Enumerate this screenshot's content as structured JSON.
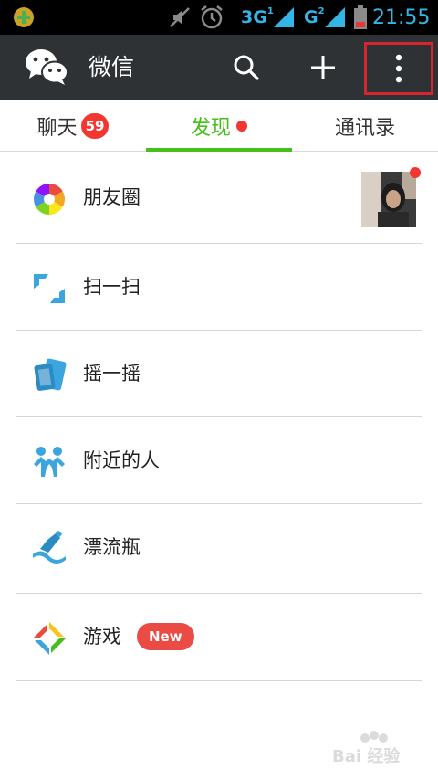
{
  "status_bar": {
    "network1": "3G",
    "sim1_tag": "1",
    "network2": "G",
    "sim2_tag": "2",
    "time": "21:55"
  },
  "action_bar": {
    "title": "微信",
    "icons": [
      "wechat-logo-icon",
      "search-icon",
      "plus-icon",
      "more-vert-icon"
    ]
  },
  "tabs": [
    {
      "label": "聊天",
      "badge": "59",
      "active": false
    },
    {
      "label": "发现",
      "dot": true,
      "active": true
    },
    {
      "label": "通讯录",
      "active": false
    }
  ],
  "discover_items": [
    {
      "label": "朋友圈",
      "icon": "moments-icon",
      "has_avatar_with_dot": true
    },
    {
      "label": "扫一扫",
      "icon": "scan-icon"
    },
    {
      "label": "摇一摇",
      "icon": "shake-icon"
    },
    {
      "label": "附近的人",
      "icon": "people-nearby-icon"
    },
    {
      "label": "漂流瓶",
      "icon": "drift-bottle-icon"
    },
    {
      "label": "游戏",
      "icon": "games-icon",
      "badge": "New"
    }
  ],
  "watermark": {
    "text": "Bai 经验"
  },
  "colors": {
    "action_bar_bg": "#2f3234",
    "accent_green": "#45c01a",
    "badge_red": "#f43530",
    "highlight_box": "#d8242e",
    "status_blue": "#33b5e5"
  }
}
